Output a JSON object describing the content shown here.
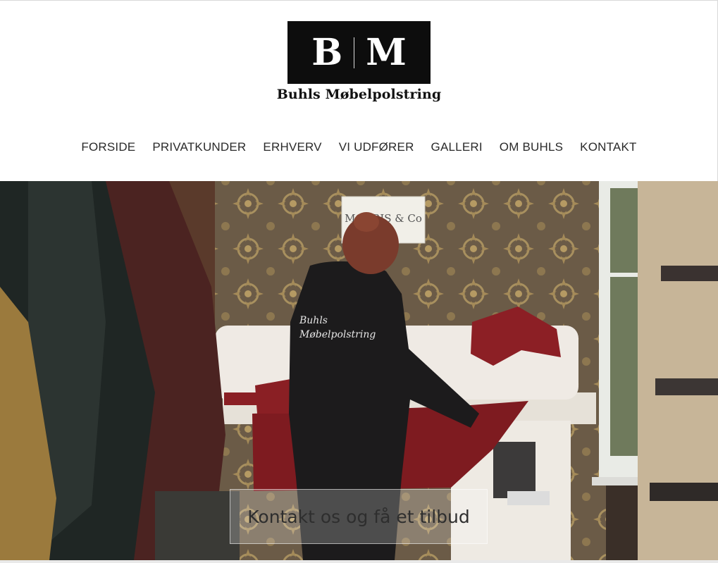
{
  "logo": {
    "letter_left": "B",
    "letter_right": "M",
    "name": "Buhls Møbelpolstring"
  },
  "nav": {
    "items": [
      {
        "label": "FORSIDE"
      },
      {
        "label": "PRIVATKUNDER"
      },
      {
        "label": "ERHVERV"
      },
      {
        "label": "VI UDFØRER"
      },
      {
        "label": "GALLERI"
      },
      {
        "label": "OM BUHLS"
      },
      {
        "label": "KONTAKT"
      }
    ]
  },
  "hero": {
    "sign_text": "MORRIS & Co",
    "hoodie_line1": "Buhls",
    "hoodie_line2": "Møbelpolstring",
    "cta_label": "Kontakt os og få et tilbud"
  },
  "colors": {
    "logo_bg": "#0d0d0d",
    "nav_text": "#2a2a2a",
    "fabric_red": "#8a1f24",
    "wallpaper": "#6a5a45"
  }
}
